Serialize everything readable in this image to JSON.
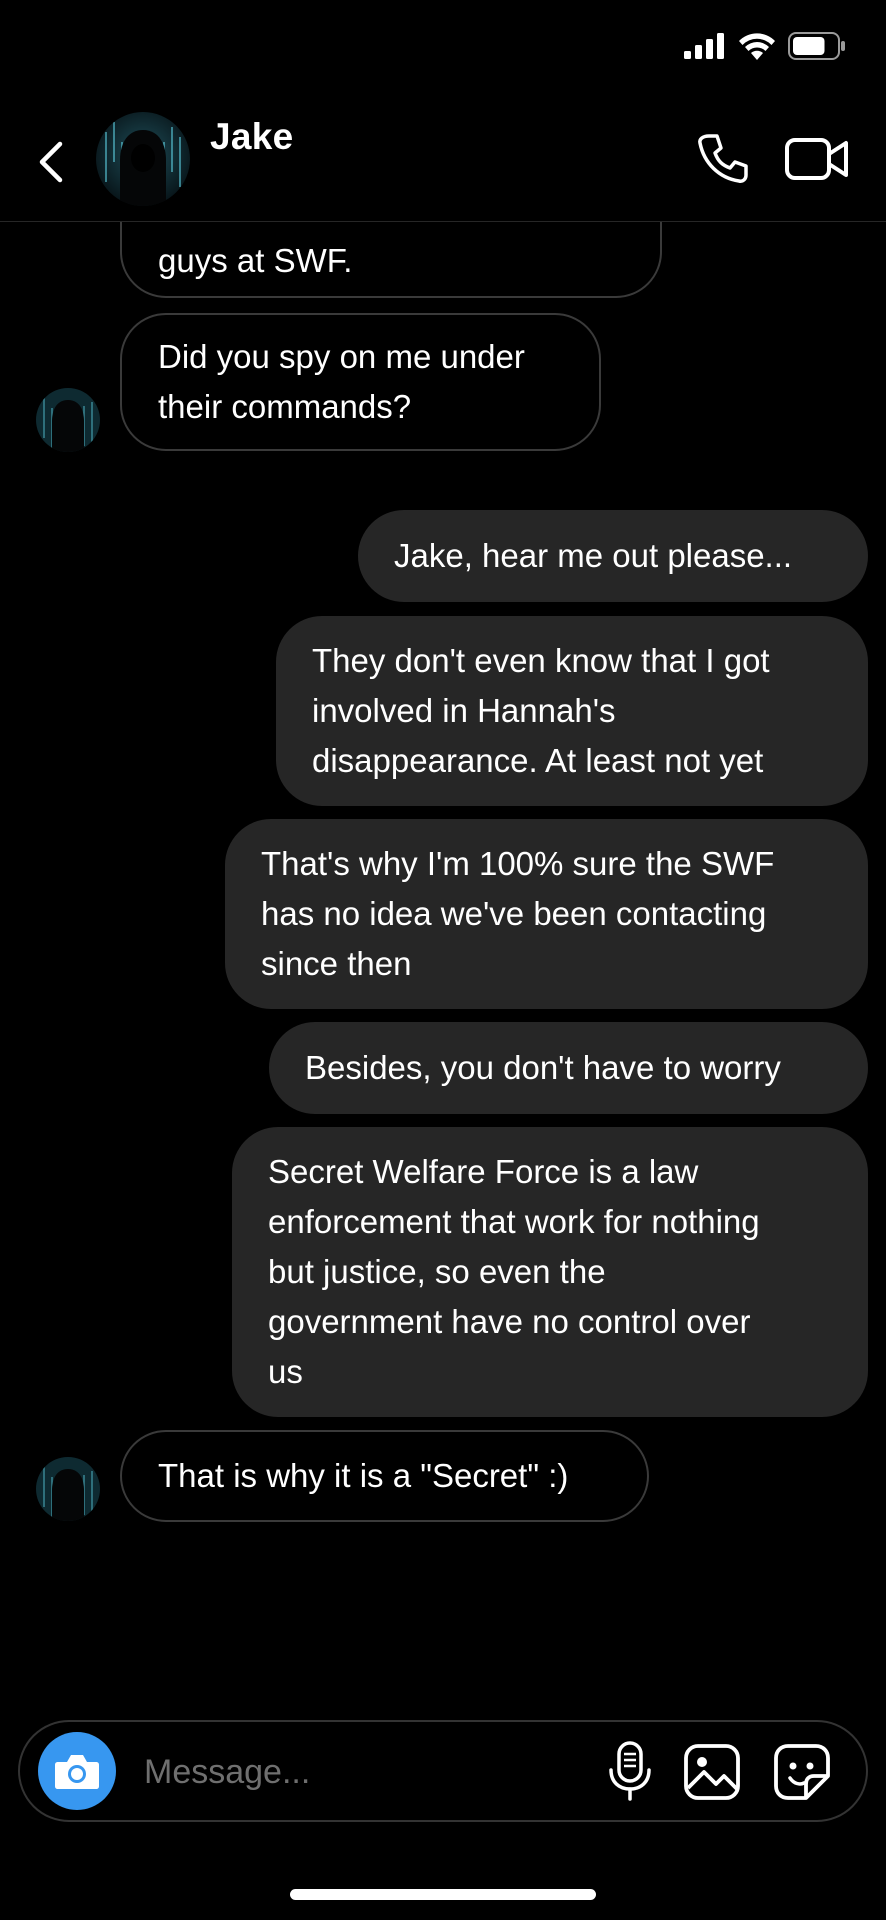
{
  "status_bar": {
    "signal_icon": "cellular-signal-icon",
    "wifi_icon": "wifi-icon",
    "battery_icon": "battery-icon",
    "battery_level": 0.75
  },
  "header": {
    "contact_name": "Jake",
    "back_icon": "chevron-left-icon",
    "call_icon": "phone-icon",
    "video_icon": "video-camera-icon"
  },
  "messages": [
    {
      "from": "them",
      "text": "guys at SWF."
    },
    {
      "from": "them",
      "text": "Did you spy on me under\ntheir commands?"
    },
    {
      "from": "me",
      "text": "Jake, hear me out please..."
    },
    {
      "from": "me",
      "text": "They don't even know that I got\ninvolved in Hannah's\ndisappearance. At least not yet"
    },
    {
      "from": "me",
      "text": "That's why I'm 100% sure the SWF\nhas no idea we've been contacting\nsince then"
    },
    {
      "from": "me",
      "text": "Besides, you don't have to worry"
    },
    {
      "from": "me",
      "text": "Secret Welfare Force is a law\nenforcement that work for nothing\nbut justice, so even the\ngovernment have no control over\nus"
    },
    {
      "from": "them",
      "text": "That is why it is a \"Secret\" :)"
    }
  ],
  "composer": {
    "placeholder": "Message...",
    "camera_icon": "camera-icon",
    "mic_icon": "microphone-icon",
    "gallery_icon": "image-icon",
    "sticker_icon": "sticker-icon"
  },
  "colors": {
    "background": "#000000",
    "outgoing_bubble": "#262626",
    "incoming_border": "#3a3a3a",
    "accent": "#3797f0",
    "text": "#ffffff"
  }
}
